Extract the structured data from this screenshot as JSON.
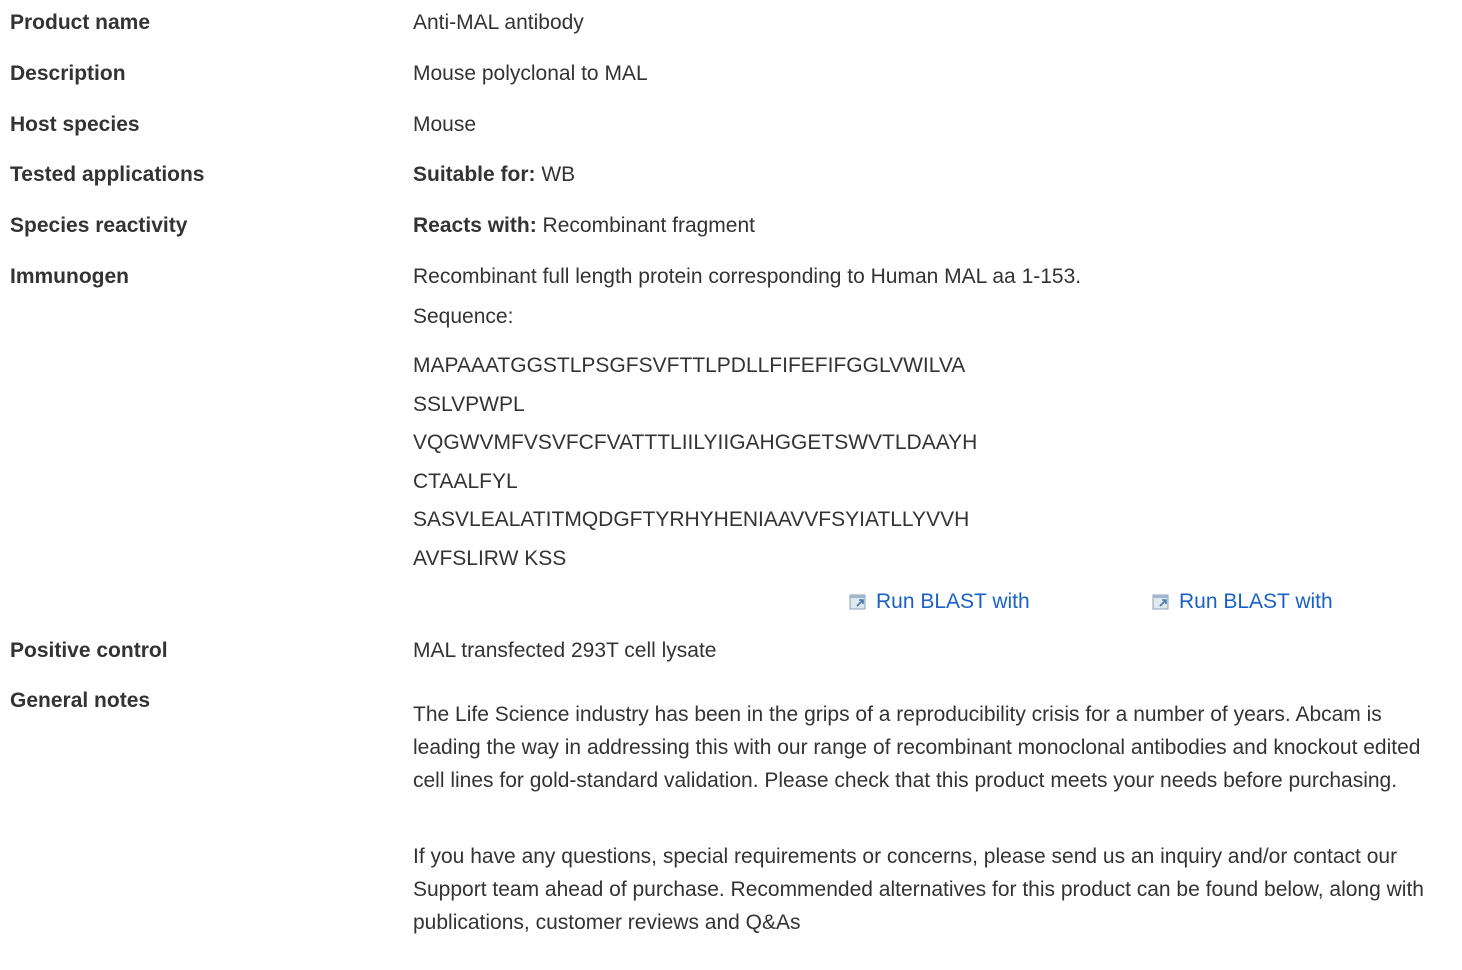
{
  "rows": {
    "product_name": {
      "label": "Product name",
      "value": "Anti-MAL antibody"
    },
    "description": {
      "label": "Description",
      "value": "Mouse polyclonal to MAL"
    },
    "host_species": {
      "label": "Host species",
      "value": "Mouse"
    },
    "tested_applications": {
      "label": "Tested applications",
      "prefix": "Suitable for:",
      "value": "WB"
    },
    "species_reactivity": {
      "label": "Species reactivity",
      "prefix": "Reacts with:",
      "value": "Recombinant fragment"
    },
    "immunogen": {
      "label": "Immunogen",
      "value": "Recombinant full length protein corresponding to Human MAL aa 1-153.",
      "sequence_label": "Sequence:",
      "sequence_lines": [
        "MAPAAATGGSTLPSGFSVFTTLPDLLFIFEFIFGGLVWILVA",
        "SSLVPWPL",
        "VQGWVMFVSVFCFVATTTLIILYIIGAHGGETSWVTLDAAYH",
        "CTAALFYL",
        "SASVLEALATITMQDGFTYRHYHENIAAVVFSYIATLLYVVH",
        "AVFSLIRW KSS"
      ],
      "blast_links": [
        "Run BLAST with",
        "Run BLAST with"
      ]
    },
    "positive_control": {
      "label": "Positive control",
      "value": "MAL transfected 293T cell lysate"
    },
    "general_notes": {
      "label": "General notes",
      "paragraphs": [
        "The Life Science industry has been in the grips of a reproducibility crisis for a number of years. Abcam is leading the way in addressing this with our range of recombinant monoclonal antibodies and knockout edited cell lines for gold-standard validation. Please check that this product meets your needs before purchasing.",
        "If you have any questions, special requirements or concerns, please send us an inquiry and/or contact our Support team ahead of purchase. Recommended alternatives for this product can be found below, along with publications, customer reviews and Q&As"
      ]
    }
  },
  "colors": {
    "text": "#333333",
    "link": "#1a61c7"
  },
  "icons": {
    "blast": "external-window-icon"
  }
}
